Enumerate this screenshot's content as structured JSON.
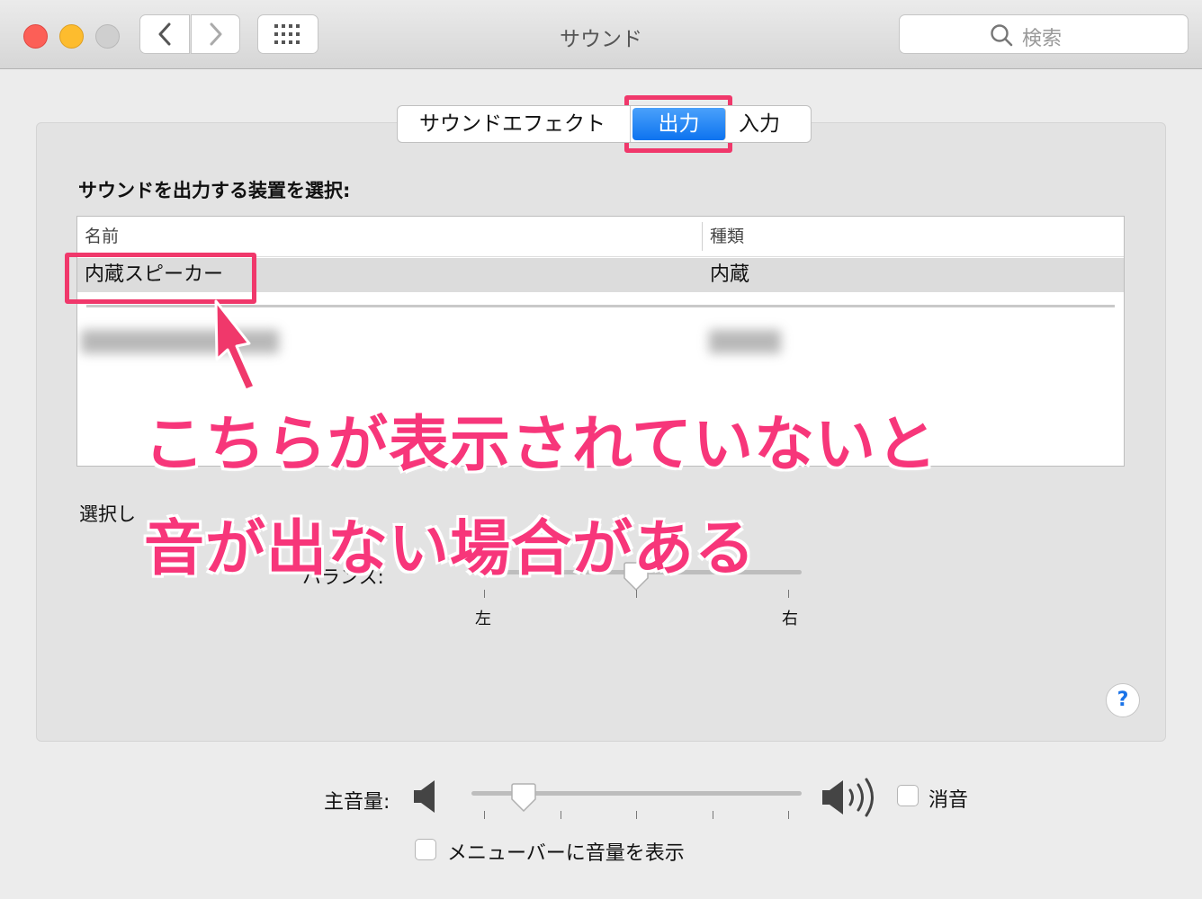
{
  "window": {
    "title": "サウンド",
    "search_placeholder": "検索"
  },
  "tabs": [
    {
      "label": "サウンドエフェクト",
      "active": false
    },
    {
      "label": "出力",
      "active": true
    },
    {
      "label": "入力",
      "active": false
    }
  ],
  "output": {
    "section_label": "サウンドを出力する装置を選択:",
    "columns": {
      "name": "名前",
      "type": "種類"
    },
    "devices": [
      {
        "name": "内蔵スピーカー",
        "type": "内蔵",
        "selected": true
      }
    ],
    "selected_device_label": "選択し",
    "balance_label": "バランス:",
    "balance_left": "左",
    "balance_right": "右",
    "balance_value": 0.5
  },
  "bottom": {
    "volume_label": "主音量:",
    "volume_level": 0.13,
    "mute_label": "消音",
    "mute_checked": false,
    "menubar_label": "メニューバーに音量を表示",
    "menubar_checked": false
  },
  "help": {
    "label": "?"
  },
  "annotation": {
    "line1": "こちらが表示されていないと",
    "line2": "音が出ない場合がある",
    "highlight_color": "#f0386b"
  }
}
